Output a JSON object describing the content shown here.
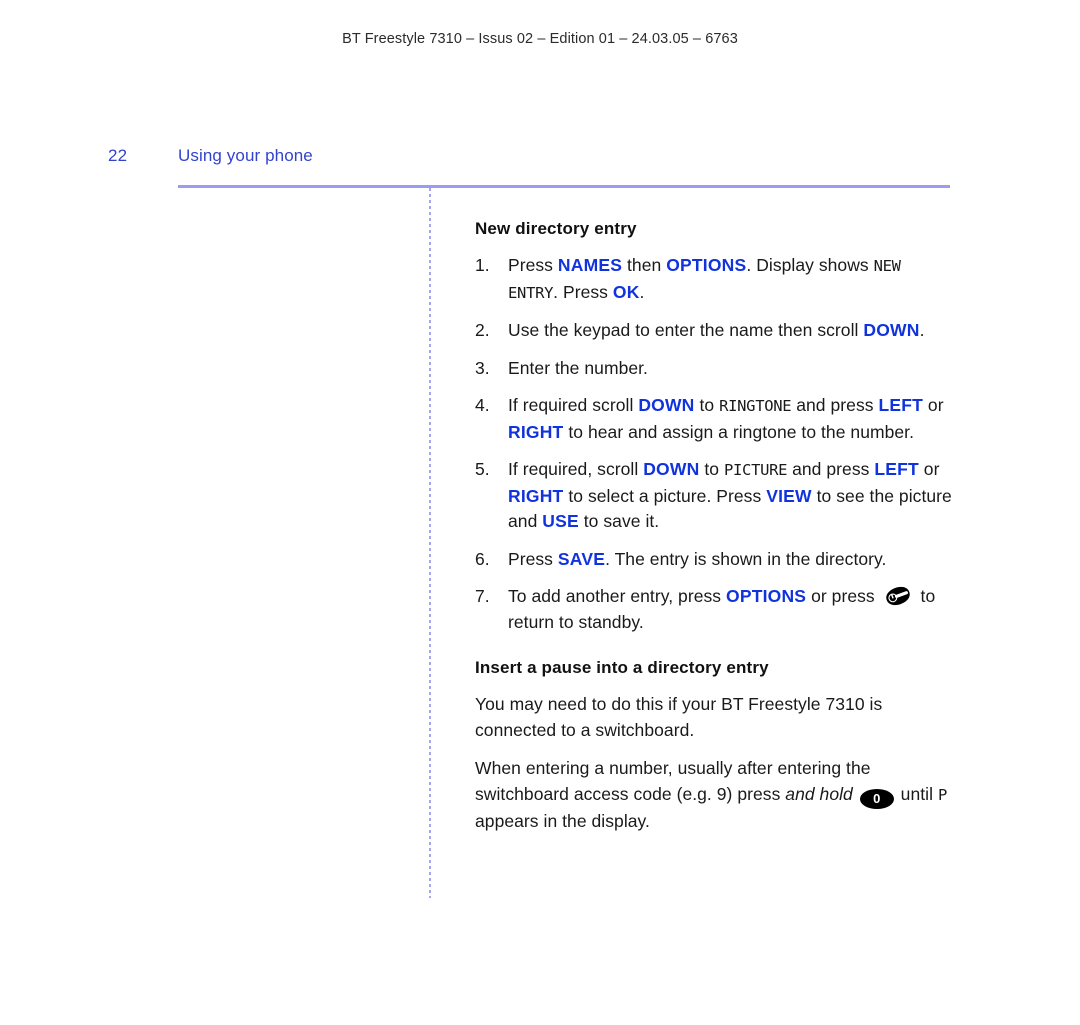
{
  "page": {
    "running_header": "BT Freestyle 7310 – Issus 02 – Edition 01 – 24.03.05 – 6763",
    "folio_number": "22",
    "section_title": "Using your phone",
    "accent_blue": "#3344cc",
    "key_blue": "#1133dd",
    "rule_color": "#9b9bf2"
  },
  "sections": [
    {
      "heading": "New directory entry",
      "steps": [
        {
          "num": "1.",
          "parts": [
            {
              "t": "Press ",
              "s": "plain"
            },
            {
              "t": "NAMES",
              "s": "key"
            },
            {
              "t": " then ",
              "s": "plain"
            },
            {
              "t": "OPTIONS",
              "s": "key"
            },
            {
              "t": ". Display shows ",
              "s": "plain"
            },
            {
              "t": "NEW ENTRY",
              "s": "lcd"
            },
            {
              "t": ". Press ",
              "s": "plain"
            },
            {
              "t": "OK",
              "s": "key"
            },
            {
              "t": ".",
              "s": "plain"
            }
          ]
        },
        {
          "num": "2.",
          "parts": [
            {
              "t": "Use the keypad to enter the name then scroll ",
              "s": "plain"
            },
            {
              "t": "DOWN",
              "s": "key"
            },
            {
              "t": ".",
              "s": "plain"
            }
          ]
        },
        {
          "num": "3.",
          "parts": [
            {
              "t": "Enter the number.",
              "s": "plain"
            }
          ]
        },
        {
          "num": "4.",
          "parts": [
            {
              "t": "If required scroll ",
              "s": "plain"
            },
            {
              "t": "DOWN",
              "s": "key"
            },
            {
              "t": " to ",
              "s": "plain"
            },
            {
              "t": "RINGTONE",
              "s": "lcd"
            },
            {
              "t": " and press ",
              "s": "plain"
            },
            {
              "t": "LEFT",
              "s": "key"
            },
            {
              "t": " or ",
              "s": "plain"
            },
            {
              "t": "RIGHT",
              "s": "key"
            },
            {
              "t": " to hear and assign a ringtone to the number.",
              "s": "plain"
            }
          ]
        },
        {
          "num": "5.",
          "parts": [
            {
              "t": "If required, scroll ",
              "s": "plain"
            },
            {
              "t": "DOWN",
              "s": "key"
            },
            {
              "t": " to ",
              "s": "plain"
            },
            {
              "t": "PICTURE",
              "s": "lcd"
            },
            {
              "t": " and press ",
              "s": "plain"
            },
            {
              "t": "LEFT",
              "s": "key"
            },
            {
              "t": " or ",
              "s": "plain"
            },
            {
              "t": "RIGHT",
              "s": "key"
            },
            {
              "t": " to select a picture. Press ",
              "s": "plain"
            },
            {
              "t": "VIEW",
              "s": "key"
            },
            {
              "t": " to see the picture and ",
              "s": "plain"
            },
            {
              "t": "USE",
              "s": "key"
            },
            {
              "t": " to save it.",
              "s": "plain"
            }
          ]
        },
        {
          "num": "6.",
          "parts": [
            {
              "t": "Press ",
              "s": "plain"
            },
            {
              "t": "SAVE",
              "s": "key"
            },
            {
              "t": ". The entry is shown in the directory.",
              "s": "plain"
            }
          ]
        },
        {
          "num": "7.",
          "parts": [
            {
              "t": "To add another entry, press ",
              "s": "plain"
            },
            {
              "t": "OPTIONS",
              "s": "key"
            },
            {
              "t": " or press ",
              "s": "plain"
            },
            {
              "t": "",
              "s": "icon-standby-key"
            },
            {
              "t": " to return to standby.",
              "s": "plain"
            }
          ]
        }
      ]
    },
    {
      "heading": "Insert a pause into a directory entry",
      "paragraphs": [
        [
          {
            "t": "You may need to do this if your BT Freestyle 7310 is connected to a switchboard.",
            "s": "plain"
          }
        ],
        [
          {
            "t": "When entering a number, usually after entering the switchboard access code (e.g. 9) press ",
            "s": "plain"
          },
          {
            "t": "and hold",
            "s": "ital"
          },
          {
            "t": " ",
            "s": "plain"
          },
          {
            "t": "0",
            "s": "keycap"
          },
          {
            "t": " until ",
            "s": "plain"
          },
          {
            "t": "P",
            "s": "lcd"
          },
          {
            "t": " appears in the display.",
            "s": "plain"
          }
        ]
      ]
    }
  ]
}
